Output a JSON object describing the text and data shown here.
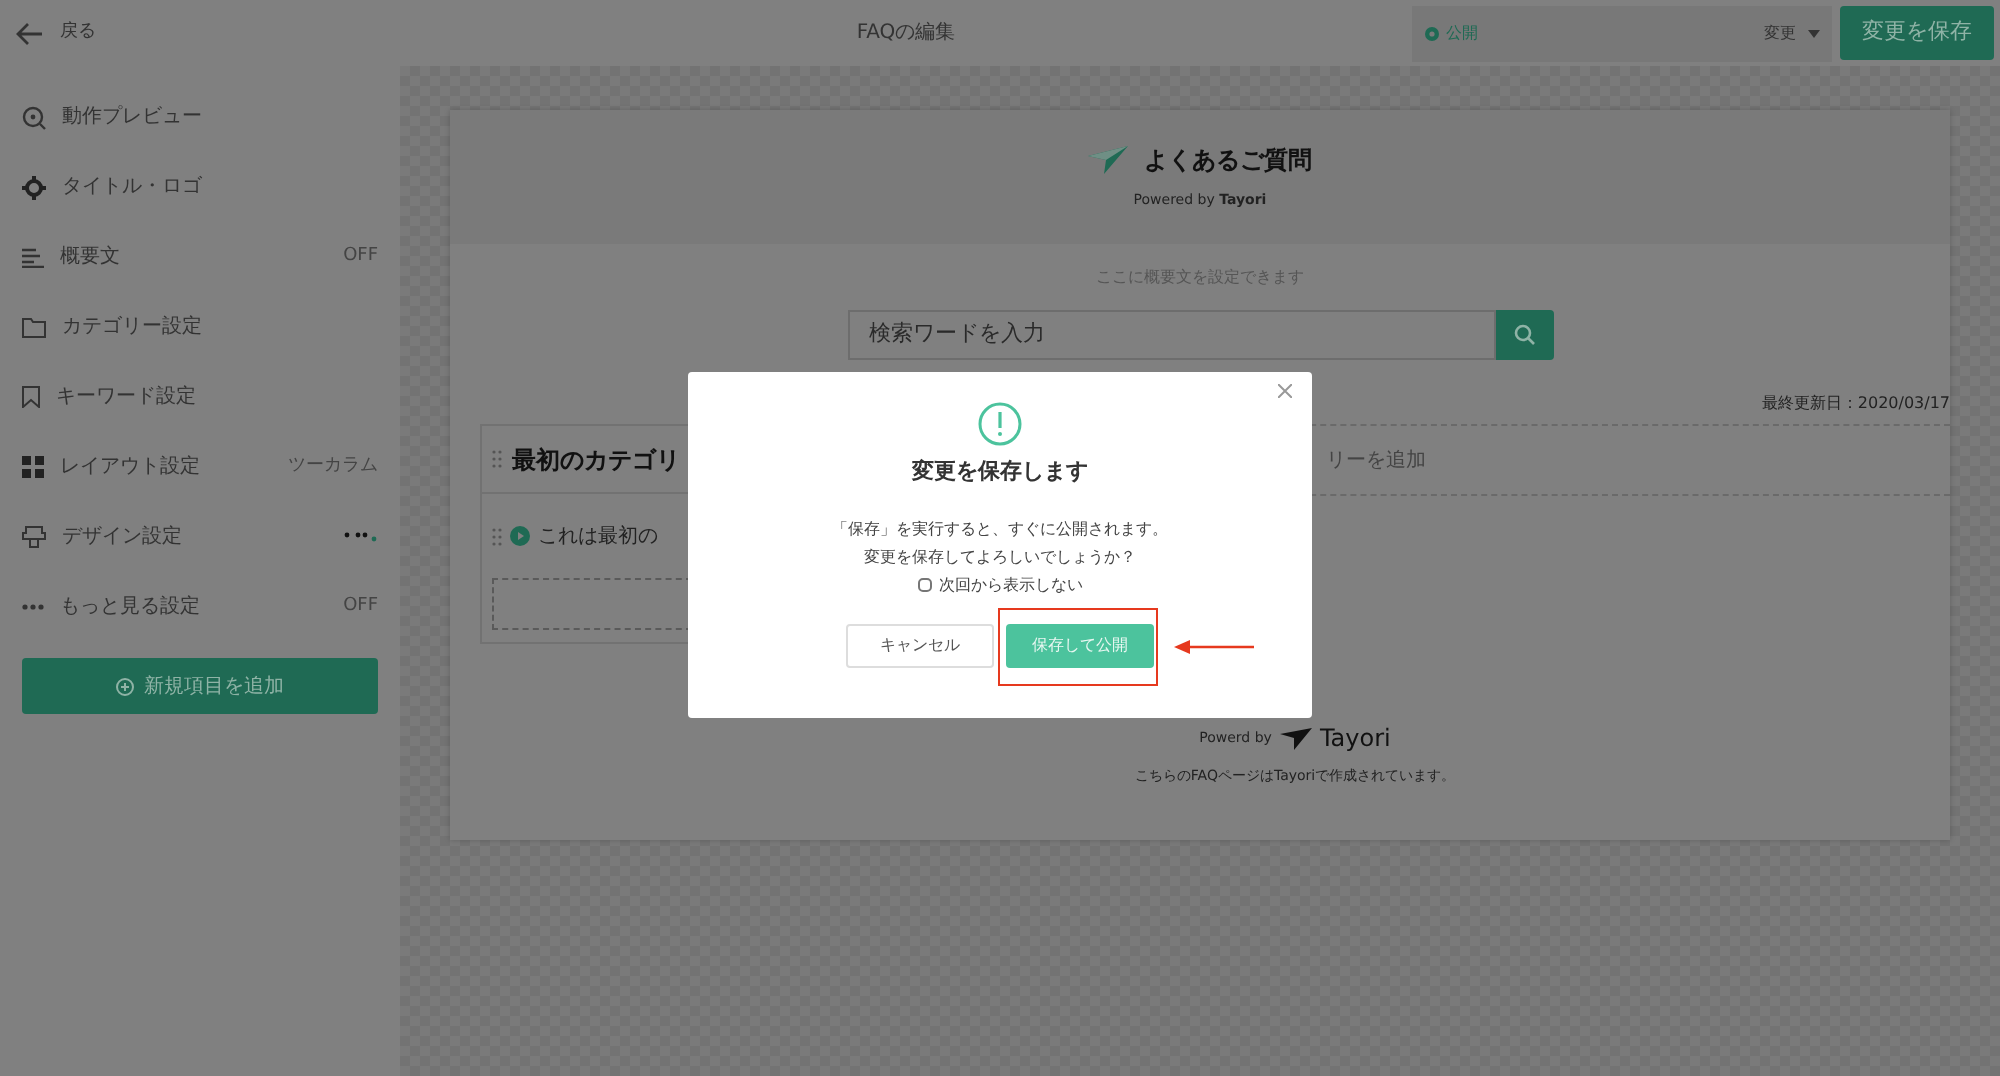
{
  "topbar": {
    "back": "戻る",
    "title": "FAQの編集",
    "status": "公開",
    "change_menu": "変更",
    "save_button": "変更を保存"
  },
  "sidebar": {
    "items": [
      {
        "label": "動作プレビュー"
      },
      {
        "label": "タイトル・ロゴ"
      },
      {
        "label": "概要文",
        "value": "OFF"
      },
      {
        "label": "カテゴリー設定"
      },
      {
        "label": "キーワード設定"
      },
      {
        "label": "レイアウト設定",
        "value": "ツーカラム"
      },
      {
        "label": "デザイン設定",
        "kind": "palette"
      },
      {
        "label": "もっと見る設定",
        "value": "OFF"
      }
    ],
    "add_button": "新規項目を追加"
  },
  "preview": {
    "title": "よくあるご質問",
    "powered": "Powered by",
    "powered_brand": "Tayori",
    "summary": "ここに概要文を設定できます",
    "search_placeholder": "検索ワードを入力",
    "updated": "最終更新日：2020/03/17",
    "category_title": "最初のカテゴリ",
    "question": "これは最初の",
    "add_category": "リーを追加",
    "footer_powered": "Powerd by",
    "footer_brand": "Tayori",
    "footer_note": {
      "before": "こちらのFAQページは",
      "link": "Tayori",
      "after": "で作成されています。"
    }
  },
  "dialog": {
    "title": "変更を保存します",
    "message_lines": [
      "「保存」を実行すると、すぐに公開されます。",
      "変更を保存してよろしいでしょうか？"
    ],
    "dont_show": {
      "label": "次回から表示しない",
      "checked": false
    },
    "cancel": "キャンセル",
    "confirm": "保存して公開",
    "highlighted": true
  }
}
